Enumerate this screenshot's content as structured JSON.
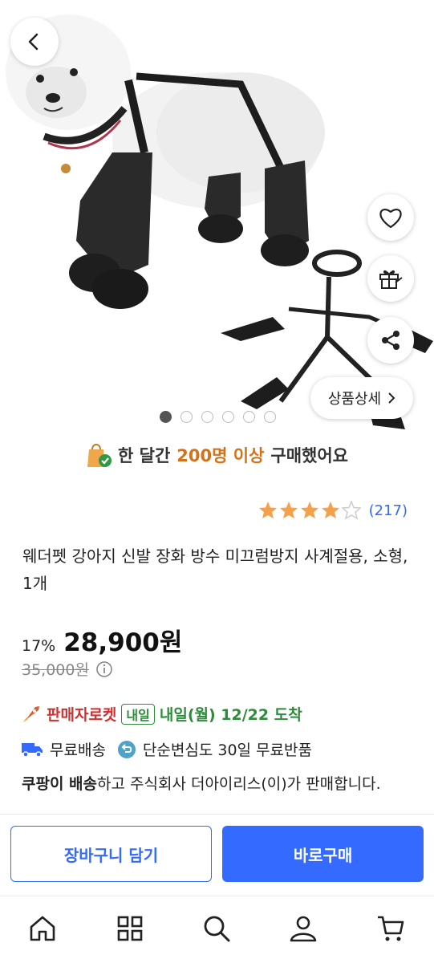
{
  "hero": {
    "image_description_icon": "dog-wearing-waterproof-suspender-boots",
    "dots_count": 6,
    "active_dot": 0
  },
  "buttons": {
    "back": "back-icon",
    "wishlist": "heart-icon",
    "gift": "gift-icon",
    "share": "share-icon",
    "detail_label": "상품상세"
  },
  "buyers": {
    "prefix": "한 달간",
    "highlight": "200명 이상",
    "suffix": "구매했어요"
  },
  "rating": {
    "stars": 4,
    "max": 5,
    "count": "(217)"
  },
  "product": {
    "title": "웨더펫 강아지 신발 장화 방수 미끄럼방지 사계절용, 소형, 1개",
    "discount": "17%",
    "price": "28,900원",
    "original_price": "35,000원"
  },
  "delivery": {
    "rocket_label": "판매자로켓",
    "tomorrow_badge": "내일",
    "arrival": "내일(월) 12/22 도착",
    "free_shipping": "무료배송",
    "return_policy": "단순변심도 30일 무료반품",
    "seller_bold": "쿠팡이 배송",
    "seller_rest": "하고 주식회사 더아이리스(이)가 판매합니다."
  },
  "cta": {
    "cart": "장바구니 담기",
    "buy": "바로구매"
  },
  "tabs": [
    "home-icon",
    "category-icon",
    "search-icon",
    "my-account-icon",
    "cart-icon"
  ],
  "colors": {
    "accent": "#346aff",
    "rocket": "#d32f2f",
    "arrival": "#2e8b3a",
    "buyers_highlight": "#d4721a",
    "star": "#f5a04a"
  }
}
